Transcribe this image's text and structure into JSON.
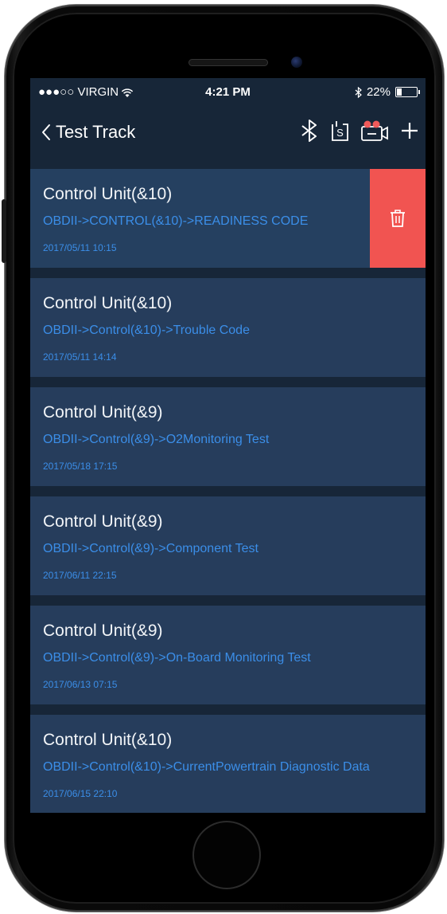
{
  "status_bar": {
    "carrier": "●●●○○ VIRGIN",
    "time": "4:21 PM",
    "battery_text": "22%",
    "battery_level": 0.22
  },
  "nav": {
    "title": "Test Track",
    "icons": [
      "bluetooth-icon",
      "s-box-icon",
      "record-camera-icon",
      "add-icon"
    ]
  },
  "records": [
    {
      "title": "Control Unit(&10)",
      "path": "OBDII->CONTROL(&10)->READINESS CODE",
      "date": "2017/05/11 10:15"
    },
    {
      "title": "Control Unit(&10)",
      "path": "OBDII->Control(&10)->Trouble Code",
      "date": "2017/05/11 14:14"
    },
    {
      "title": "Control Unit(&9)",
      "path": "OBDII->Control(&9)->O2Monitoring Test",
      "date": "2017/05/18 17:15"
    },
    {
      "title": "Control Unit(&9)",
      "path": "OBDII->Control(&9)->Component Test",
      "date": "2017/06/11 22:15"
    },
    {
      "title": "Control Unit(&9)",
      "path": "OBDII->Control(&9)->On-Board Monitoring Test",
      "date": "2017/06/13 07:15"
    },
    {
      "title": "Control Unit(&10)",
      "path": "OBDII->Control(&10)->CurrentPowertrain Diagnostic Data",
      "date": "2017/06/15 22:10"
    }
  ],
  "colors": {
    "screen_bg": "#172638",
    "card_bg": "#263d5c",
    "accent_blue": "#3b8ee8",
    "delete_red": "#f15451"
  }
}
